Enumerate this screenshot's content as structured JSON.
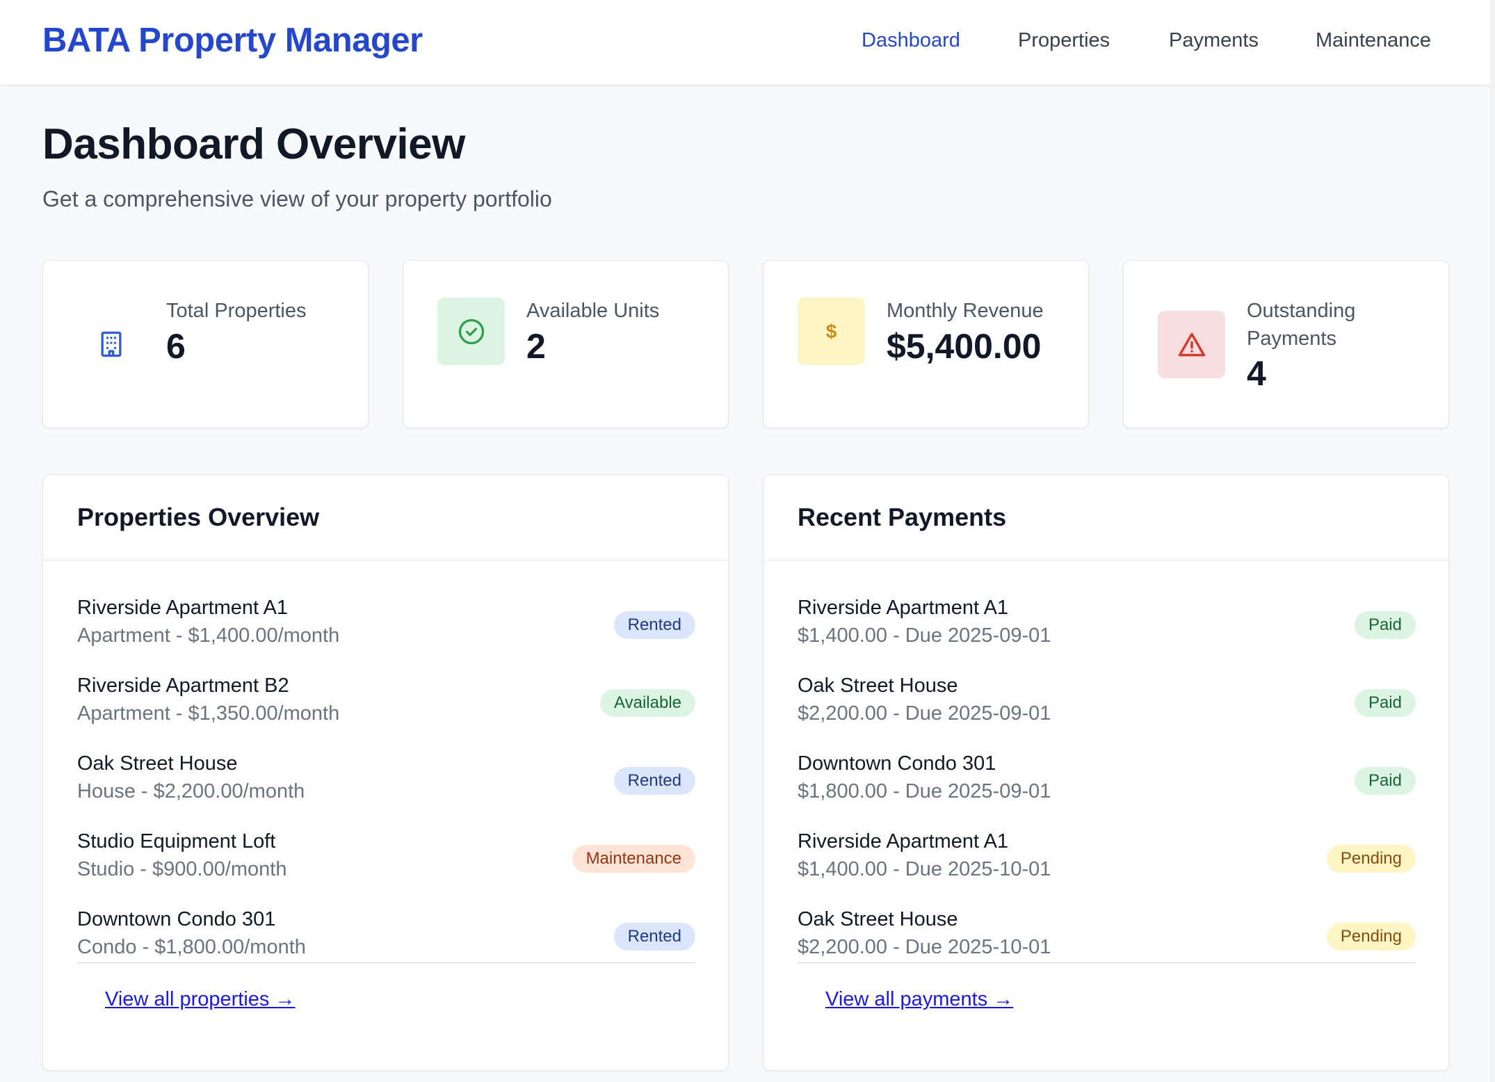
{
  "header": {
    "brand": "BATA Property Manager",
    "nav": [
      {
        "label": "Dashboard",
        "active": true
      },
      {
        "label": "Properties",
        "active": false
      },
      {
        "label": "Payments",
        "active": false
      },
      {
        "label": "Maintenance",
        "active": false
      }
    ]
  },
  "page": {
    "title": "Dashboard Overview",
    "subtitle": "Get a comprehensive view of your property portfolio"
  },
  "stats": [
    {
      "label": "Total Properties",
      "value": "6",
      "icon": "building-icon",
      "color": "#2f5bd3"
    },
    {
      "label": "Available Units",
      "value": "2",
      "icon": "check-circle-icon",
      "color": "#2f9e4f"
    },
    {
      "label": "Monthly Revenue",
      "value": "$5,400.00",
      "icon": "dollar-icon",
      "color": "#d08a13"
    },
    {
      "label": "Outstanding Payments",
      "value": "4",
      "icon": "warning-icon",
      "color": "#d03a2f"
    }
  ],
  "properties_panel": {
    "title": "Properties Overview",
    "items": [
      {
        "name": "Riverside Apartment A1",
        "detail": "Apartment - $1,400.00/month",
        "status": "Rented"
      },
      {
        "name": "Riverside Apartment B2",
        "detail": "Apartment - $1,350.00/month",
        "status": "Available"
      },
      {
        "name": "Oak Street House",
        "detail": "House - $2,200.00/month",
        "status": "Rented"
      },
      {
        "name": "Studio Equipment Loft",
        "detail": "Studio - $900.00/month",
        "status": "Maintenance"
      },
      {
        "name": "Downtown Condo 301",
        "detail": "Condo - $1,800.00/month",
        "status": "Rented"
      }
    ],
    "link": "View all properties →"
  },
  "payments_panel": {
    "title": "Recent Payments",
    "items": [
      {
        "name": "Riverside Apartment A1",
        "detail": "$1,400.00 - Due 2025-09-01",
        "status": "Paid"
      },
      {
        "name": "Oak Street House",
        "detail": "$2,200.00 - Due 2025-09-01",
        "status": "Paid"
      },
      {
        "name": "Downtown Condo 301",
        "detail": "$1,800.00 - Due 2025-09-01",
        "status": "Paid"
      },
      {
        "name": "Riverside Apartment A1",
        "detail": "$1,400.00 - Due 2025-10-01",
        "status": "Pending"
      },
      {
        "name": "Oak Street House",
        "detail": "$2,200.00 - Due 2025-10-01",
        "status": "Pending"
      }
    ],
    "link": "View all payments →"
  },
  "colors": {
    "brand": "#2447cc",
    "link": "#1a1ae0"
  }
}
